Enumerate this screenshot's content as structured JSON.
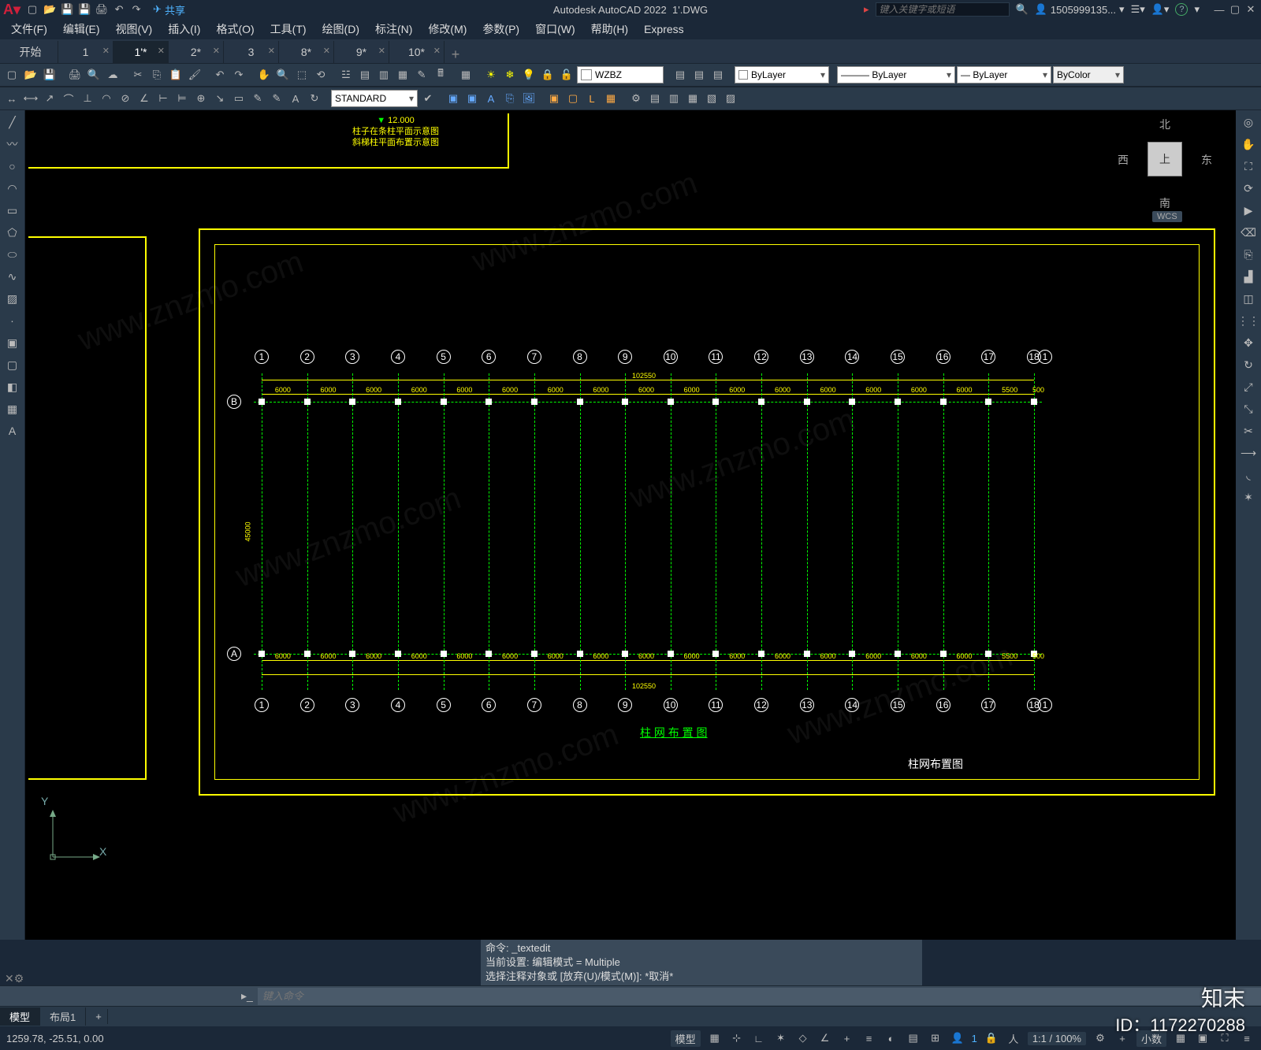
{
  "title_app": "Autodesk AutoCAD 2022",
  "title_file": "1'.DWG",
  "search_placeholder": "键入关键字或短语",
  "user_name": "1505999135...",
  "share_label": "共享",
  "menu": [
    "文件(F)",
    "编辑(E)",
    "视图(V)",
    "插入(I)",
    "格式(O)",
    "工具(T)",
    "绘图(D)",
    "标注(N)",
    "修改(M)",
    "参数(P)",
    "窗口(W)",
    "帮助(H)",
    "Express"
  ],
  "tabs": [
    {
      "label": "开始",
      "close": false,
      "active": false
    },
    {
      "label": "1",
      "close": true,
      "active": false
    },
    {
      "label": "1'*",
      "close": true,
      "active": true
    },
    {
      "label": "2*",
      "close": true,
      "active": false
    },
    {
      "label": "3",
      "close": true,
      "active": false
    },
    {
      "label": "8*",
      "close": true,
      "active": false
    },
    {
      "label": "9*",
      "close": true,
      "active": false
    },
    {
      "label": "10*",
      "close": true,
      "active": false
    }
  ],
  "layer_input": "WZBZ",
  "layer_combo": "ByLayer",
  "linetype_combo": "ByLayer",
  "lineweight_combo": "ByLayer",
  "plotstyle_combo": "ByColor",
  "textstyle_combo": "STANDARD",
  "viewcube": {
    "n": "北",
    "s": "南",
    "e": "东",
    "w": "西",
    "top": "上",
    "wcs": "WCS"
  },
  "top_caption": {
    "elev": "12.000",
    "l1": "柱子在条柱平面示意图",
    "l2": "斜梯柱平面布置示意图"
  },
  "grid_numbers": [
    "1",
    "2",
    "3",
    "4",
    "5",
    "6",
    "7",
    "8",
    "9",
    "10",
    "11",
    "12",
    "13",
    "14",
    "15",
    "16",
    "17",
    "18"
  ],
  "grid_extra_top": "1",
  "grid_letters": [
    "A",
    "B"
  ],
  "dim_span": "6000",
  "dim_end1": "5500",
  "dim_end2": "500",
  "dim_total": "102550",
  "dim_vert": "45000",
  "drawing_title_cn": "柱 网 布 置 图",
  "drawing_title_corner": "柱网布置图",
  "ucs": {
    "x": "X",
    "y": "Y"
  },
  "cmd_history": [
    "命令: _textedit",
    "当前设置: 编辑模式 = Multiple",
    "选择注释对象或 [放弃(U)/模式(M)]: *取消*"
  ],
  "cmd_placeholder": "键入命令",
  "bottom_tabs": [
    "模型",
    "布局1"
  ],
  "status_coords": "1259.78, -25.51, 0.00",
  "status_modelbtn": "模型",
  "status_scale": "1:1 / 100%",
  "status_decimal": "小数",
  "status_people": "1",
  "watermark_brand": "知末",
  "watermark_id": "ID：1172270288",
  "wm_url": "www.znzmo.com"
}
